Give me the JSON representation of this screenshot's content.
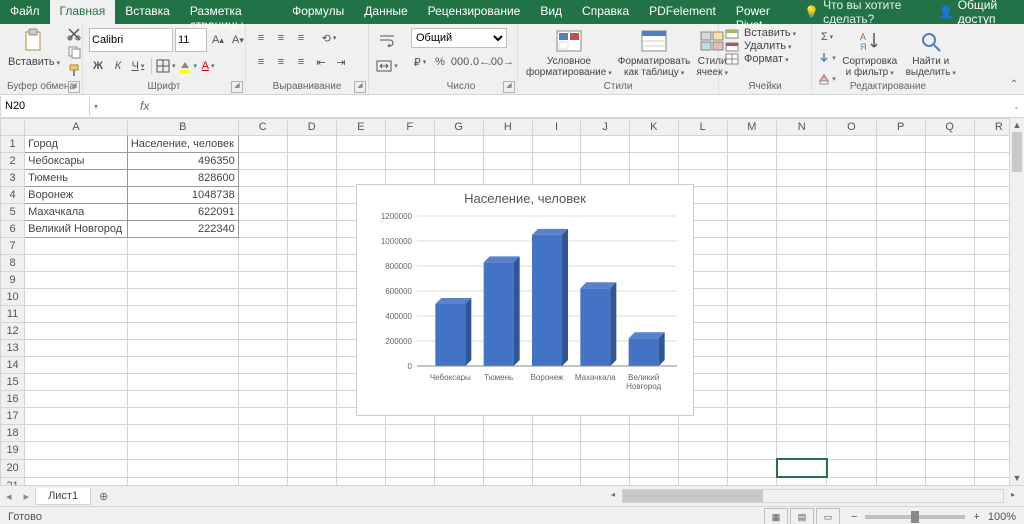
{
  "tabs": {
    "file": "Файл",
    "home": "Главная",
    "insert": "Вставка",
    "layout": "Разметка страницы",
    "formulas": "Формулы",
    "data": "Данные",
    "review": "Рецензирование",
    "view": "Вид",
    "help": "Справка",
    "pdf": "PDFelement",
    "pivot": "Power Pivot",
    "tellme": "Что вы хотите сделать?",
    "share": "Общий доступ"
  },
  "ribbon": {
    "clipboard": {
      "label": "Буфер обмена",
      "paste": "Вставить"
    },
    "font": {
      "label": "Шрифт",
      "name": "Calibri",
      "size": "11"
    },
    "align": {
      "label": "Выравнивание"
    },
    "number": {
      "label": "Число",
      "format": "Общий"
    },
    "styles": {
      "label": "Стили",
      "cond": "Условное форматирование",
      "table": "Форматировать как таблицу",
      "cell": "Стили ячеек"
    },
    "cells": {
      "label": "Ячейки",
      "insert": "Вставить",
      "delete": "Удалить",
      "format": "Формат"
    },
    "editing": {
      "label": "Редактирование",
      "sort": "Сортировка и фильтр",
      "find": "Найти и выделить"
    }
  },
  "namebox": "N20",
  "columns": [
    "A",
    "B",
    "C",
    "D",
    "E",
    "F",
    "G",
    "H",
    "I",
    "J",
    "K",
    "L",
    "M",
    "N",
    "O",
    "P",
    "Q",
    "R"
  ],
  "rows_shown": 22,
  "data_grid": {
    "headers": [
      "Город",
      "Население, человек"
    ],
    "rows": [
      [
        "Чебоксары",
        "496350"
      ],
      [
        "Тюмень",
        "828600"
      ],
      [
        "Воронеж",
        "1048738"
      ],
      [
        "Махачкала",
        "622091"
      ],
      [
        "Великий Новгород",
        "222340"
      ]
    ]
  },
  "selected_cell": {
    "row": 20,
    "col": "N"
  },
  "chart_data": {
    "type": "bar",
    "title": "Население, человек",
    "categories": [
      "Чебоксары",
      "Тюмень",
      "Воронеж",
      "Махачкала",
      "Великий Новгород"
    ],
    "values": [
      496350,
      828600,
      1048738,
      622091,
      222340
    ],
    "ylim": [
      0,
      1200000
    ],
    "yticks": [
      0,
      200000,
      400000,
      600000,
      800000,
      1000000,
      1200000
    ],
    "xlabel": "",
    "ylabel": ""
  },
  "sheet": {
    "name": "Лист1"
  },
  "status": {
    "ready": "Готово",
    "zoom": "100%",
    "minus": "−",
    "plus": "+"
  }
}
